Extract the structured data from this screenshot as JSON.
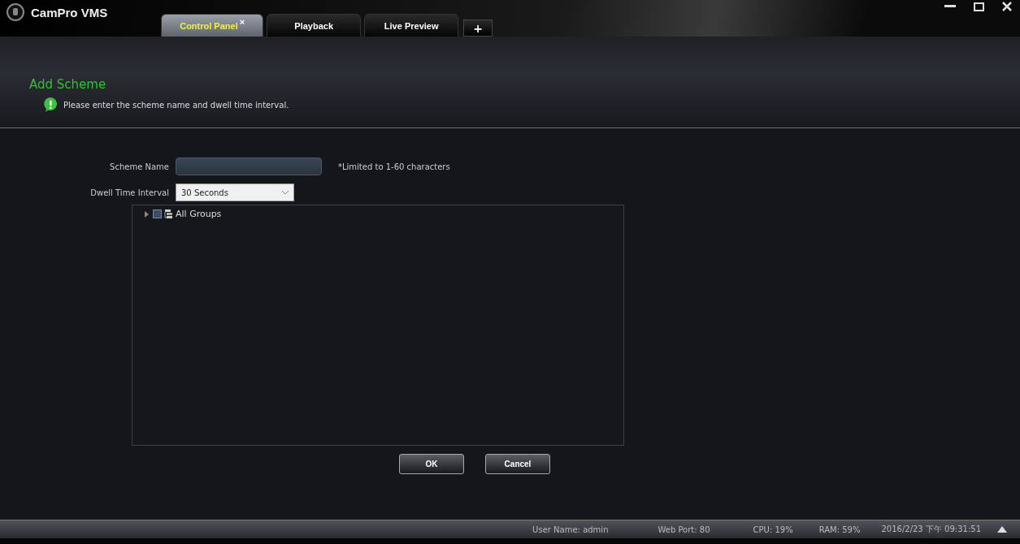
{
  "app": {
    "title": "CamPro VMS"
  },
  "tabs": [
    {
      "label": "Control Panel",
      "selected": true,
      "close": "×"
    },
    {
      "label": "Playback",
      "selected": false
    },
    {
      "label": "Live Preview",
      "selected": false
    }
  ],
  "add_tab": "+",
  "page": {
    "title": "Add Scheme",
    "hint": "Please enter the scheme name and dwell time interval."
  },
  "form": {
    "scheme_name": {
      "label": "Scheme Name",
      "note": "*Limited to 1-60 characters"
    },
    "dwell": {
      "label": "Dwell Time Interval",
      "value": "30 Seconds"
    }
  },
  "tree": [
    {
      "label": "All Groups",
      "checked": false,
      "expanded": false
    }
  ],
  "buttons": [
    "OK",
    "Cancel"
  ],
  "status_bar": [
    "User Name: admin",
    "Web Port: 80",
    "CPU: 19%",
    "RAM: 59%",
    "2016/2/23 下午 09:31:51"
  ]
}
